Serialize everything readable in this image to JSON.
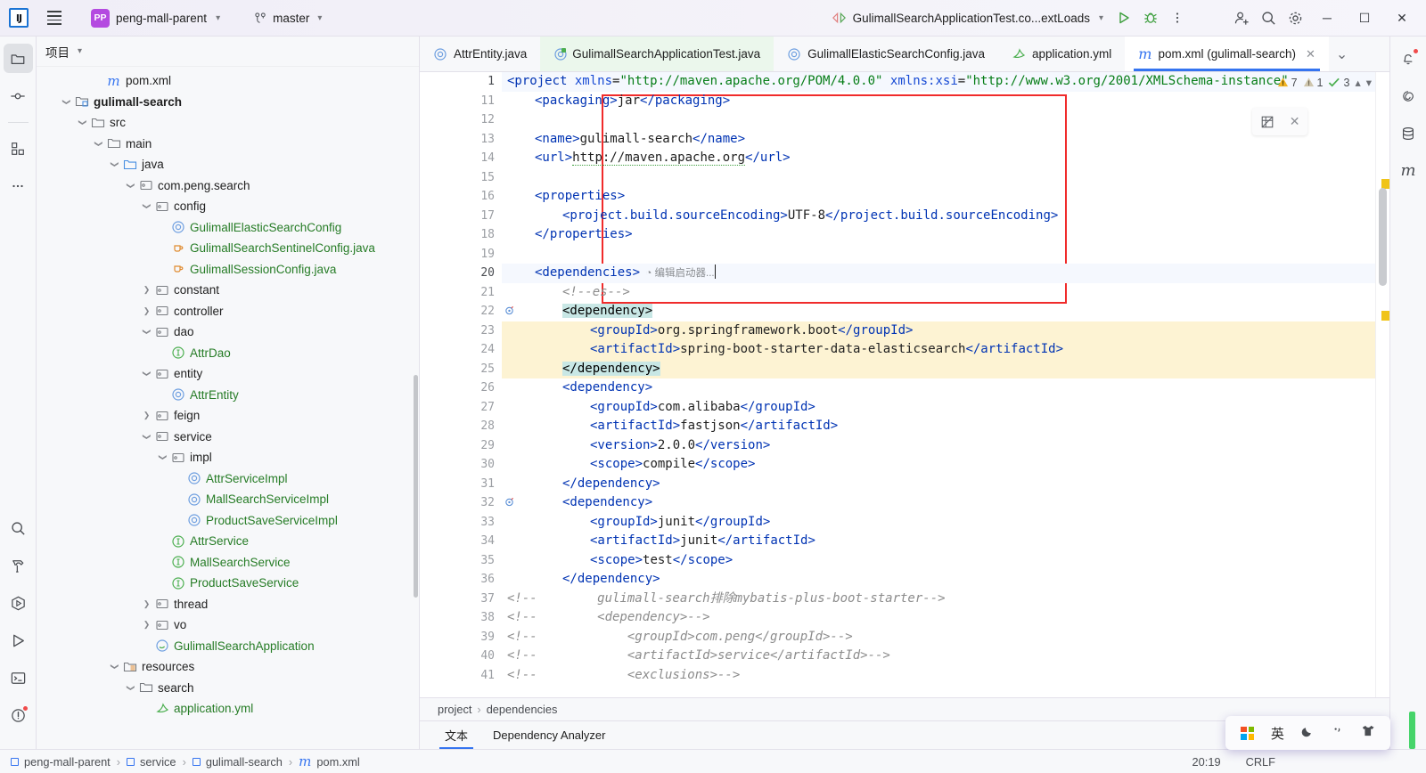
{
  "titlebar": {
    "logo": "IJ",
    "project_name": "peng-mall-parent",
    "project_badge": "PP",
    "branch": "master",
    "run_config": "GulimallSearchApplicationTest.co...extLoads",
    "icons": {
      "menu": "hamburger-icon",
      "branch": "vcs-branch-icon",
      "run": "run-icon",
      "debug": "debug-icon",
      "more": "more-vertical-icon",
      "add_user": "add-user-icon",
      "search": "search-icon",
      "settings": "gear-icon"
    },
    "window": {
      "minimize": "─",
      "maximize": "☐",
      "close": "✕"
    }
  },
  "left_rail": [
    {
      "name": "project",
      "icon": "folder-icon",
      "selected": true
    },
    {
      "name": "commit",
      "icon": "commit-icon",
      "selected": false
    },
    {
      "name": "structure",
      "icon": "structure-icon",
      "selected": false
    },
    {
      "name": "more-tool-windows",
      "icon": "more-horizontal-icon",
      "selected": false
    },
    {
      "name": "search-everywhere",
      "icon": "search-icon",
      "selected": false
    },
    {
      "name": "build",
      "icon": "hammer-icon",
      "selected": false
    },
    {
      "name": "run-dashboard",
      "icon": "run-dashboard-icon",
      "selected": false
    },
    {
      "name": "run",
      "icon": "run-icon",
      "selected": false
    },
    {
      "name": "terminal",
      "icon": "terminal-icon",
      "selected": false
    },
    {
      "name": "problems",
      "icon": "problems-icon",
      "selected": false,
      "badge": true
    }
  ],
  "right_rail": [
    {
      "name": "notifications",
      "icon": "bell-icon",
      "badge": true
    },
    {
      "name": "ai-assistant",
      "icon": "spiral-icon",
      "badge": false
    },
    {
      "name": "database",
      "icon": "database-icon",
      "badge": false
    },
    {
      "name": "maven",
      "icon": "maven-m-icon",
      "badge": false
    }
  ],
  "project_panel": {
    "title": "项目",
    "tree": [
      {
        "indent": 3,
        "arrow": "",
        "icon": "maven-m",
        "label": "pom.xml",
        "color": "default",
        "bold": false
      },
      {
        "indent": 1,
        "arrow": "v",
        "icon": "module",
        "label": "gulimall-search",
        "color": "default",
        "bold": true
      },
      {
        "indent": 2,
        "arrow": "v",
        "icon": "folder",
        "label": "src",
        "color": "default",
        "bold": false
      },
      {
        "indent": 3,
        "arrow": "v",
        "icon": "folder",
        "label": "main",
        "color": "default",
        "bold": false
      },
      {
        "indent": 4,
        "arrow": "v",
        "icon": "src-folder",
        "label": "java",
        "color": "default",
        "bold": false
      },
      {
        "indent": 5,
        "arrow": "v",
        "icon": "package",
        "label": "com.peng.search",
        "color": "default",
        "bold": false
      },
      {
        "indent": 6,
        "arrow": "v",
        "icon": "package",
        "label": "config",
        "color": "default",
        "bold": false
      },
      {
        "indent": 7,
        "arrow": "",
        "icon": "class",
        "label": "GulimallElasticSearchConfig",
        "color": "green",
        "bold": false
      },
      {
        "indent": 7,
        "arrow": "",
        "icon": "java",
        "label": "GulimallSearchSentinelConfig.java",
        "color": "green",
        "bold": false
      },
      {
        "indent": 7,
        "arrow": "",
        "icon": "java",
        "label": "GulimallSessionConfig.java",
        "color": "green",
        "bold": false
      },
      {
        "indent": 6,
        "arrow": ">",
        "icon": "package",
        "label": "constant",
        "color": "default",
        "bold": false
      },
      {
        "indent": 6,
        "arrow": ">",
        "icon": "package",
        "label": "controller",
        "color": "default",
        "bold": false
      },
      {
        "indent": 6,
        "arrow": "v",
        "icon": "package",
        "label": "dao",
        "color": "default",
        "bold": false
      },
      {
        "indent": 7,
        "arrow": "",
        "icon": "interface",
        "label": "AttrDao",
        "color": "green",
        "bold": false
      },
      {
        "indent": 6,
        "arrow": "v",
        "icon": "package",
        "label": "entity",
        "color": "default",
        "bold": false
      },
      {
        "indent": 7,
        "arrow": "",
        "icon": "class",
        "label": "AttrEntity",
        "color": "green",
        "bold": false
      },
      {
        "indent": 6,
        "arrow": ">",
        "icon": "package",
        "label": "feign",
        "color": "default",
        "bold": false
      },
      {
        "indent": 6,
        "arrow": "v",
        "icon": "package",
        "label": "service",
        "color": "default",
        "bold": false
      },
      {
        "indent": 7,
        "arrow": "v",
        "icon": "package",
        "label": "impl",
        "color": "default",
        "bold": false
      },
      {
        "indent": 8,
        "arrow": "",
        "icon": "class",
        "label": "AttrServiceImpl",
        "color": "green",
        "bold": false
      },
      {
        "indent": 8,
        "arrow": "",
        "icon": "class",
        "label": "MallSearchServiceImpl",
        "color": "green",
        "bold": false
      },
      {
        "indent": 8,
        "arrow": "",
        "icon": "class",
        "label": "ProductSaveServiceImpl",
        "color": "green",
        "bold": false
      },
      {
        "indent": 7,
        "arrow": "",
        "icon": "interface",
        "label": "AttrService",
        "color": "green",
        "bold": false
      },
      {
        "indent": 7,
        "arrow": "",
        "icon": "interface",
        "label": "MallSearchService",
        "color": "green",
        "bold": false
      },
      {
        "indent": 7,
        "arrow": "",
        "icon": "interface",
        "label": "ProductSaveService",
        "color": "green",
        "bold": false
      },
      {
        "indent": 6,
        "arrow": ">",
        "icon": "package",
        "label": "thread",
        "color": "default",
        "bold": false
      },
      {
        "indent": 6,
        "arrow": ">",
        "icon": "package",
        "label": "vo",
        "color": "default",
        "bold": false
      },
      {
        "indent": 6,
        "arrow": "",
        "icon": "spring",
        "label": "GulimallSearchApplication",
        "color": "green",
        "bold": false
      },
      {
        "indent": 4,
        "arrow": "v",
        "icon": "resources",
        "label": "resources",
        "color": "default",
        "bold": false
      },
      {
        "indent": 5,
        "arrow": "v",
        "icon": "folder",
        "label": "search",
        "color": "default",
        "bold": false
      },
      {
        "indent": 6,
        "arrow": "",
        "icon": "yml",
        "label": "application.yml",
        "color": "green",
        "bold": false
      }
    ]
  },
  "editor_tabs": [
    {
      "label": "AttrEntity.java",
      "icon": "class-icon",
      "state": "normal"
    },
    {
      "label": "GulimallSearchApplicationTest.java",
      "icon": "test-class-icon",
      "state": "run-context"
    },
    {
      "label": "GulimallElasticSearchConfig.java",
      "icon": "class-icon",
      "state": "normal"
    },
    {
      "label": "application.yml",
      "icon": "yml-icon",
      "state": "normal"
    },
    {
      "label": "pom.xml (gulimall-search)",
      "icon": "maven-m-icon",
      "state": "active"
    }
  ],
  "inspections": {
    "warnings": "7",
    "weak_warnings": "1",
    "checks": "3"
  },
  "code": {
    "filename": "pom.xml",
    "inlay_hint": "编辑启动器...",
    "lines": [
      {
        "num": "1",
        "indent": 0,
        "current": true,
        "highlight": false,
        "mark": "",
        "parts": [
          {
            "t": "tag",
            "v": "<project "
          },
          {
            "t": "attr",
            "v": "xmlns"
          },
          {
            "t": "val",
            "v": "="
          },
          {
            "t": "str",
            "v": "\"http://maven.apache.org/POM/4.0.0\""
          },
          {
            "t": "val",
            "v": " "
          },
          {
            "t": "attr",
            "v": "xmlns:xsi"
          },
          {
            "t": "val",
            "v": "="
          },
          {
            "t": "str",
            "v": "\"http://www.w3.org/2001/XMLSchema-instance\""
          }
        ]
      },
      {
        "num": "11",
        "indent": 1,
        "current": false,
        "highlight": false,
        "mark": "",
        "parts": [
          {
            "t": "tag",
            "v": "<packaging>"
          },
          {
            "t": "val",
            "v": "jar"
          },
          {
            "t": "tag",
            "v": "</packaging>"
          }
        ]
      },
      {
        "num": "12",
        "indent": 0,
        "current": false,
        "highlight": false,
        "mark": "",
        "parts": []
      },
      {
        "num": "13",
        "indent": 1,
        "current": false,
        "highlight": false,
        "mark": "",
        "parts": [
          {
            "t": "tag",
            "v": "<name>"
          },
          {
            "t": "val",
            "v": "gulimall-search"
          },
          {
            "t": "tag",
            "v": "</name>"
          }
        ]
      },
      {
        "num": "14",
        "indent": 1,
        "current": false,
        "highlight": false,
        "mark": "",
        "parts": [
          {
            "t": "tag",
            "v": "<url>"
          },
          {
            "t": "wiggle",
            "v": "http://maven.apache.org"
          },
          {
            "t": "tag",
            "v": "</url>"
          }
        ]
      },
      {
        "num": "15",
        "indent": 0,
        "current": false,
        "highlight": false,
        "mark": "",
        "parts": []
      },
      {
        "num": "16",
        "indent": 1,
        "current": false,
        "highlight": false,
        "mark": "",
        "parts": [
          {
            "t": "tag",
            "v": "<properties>"
          }
        ]
      },
      {
        "num": "17",
        "indent": 2,
        "current": false,
        "highlight": false,
        "mark": "",
        "parts": [
          {
            "t": "tag",
            "v": "<project.build.sourceEncoding>"
          },
          {
            "t": "val",
            "v": "UTF-8"
          },
          {
            "t": "tag",
            "v": "</project.build.sourceEncoding>"
          }
        ]
      },
      {
        "num": "18",
        "indent": 1,
        "current": false,
        "highlight": false,
        "mark": "",
        "parts": [
          {
            "t": "tag",
            "v": "</properties>"
          }
        ]
      },
      {
        "num": "19",
        "indent": 0,
        "current": false,
        "highlight": false,
        "mark": "",
        "parts": []
      },
      {
        "num": "20",
        "indent": 1,
        "current": true,
        "highlight": false,
        "mark": "",
        "parts": [
          {
            "t": "tag",
            "v": "<dependencies>"
          },
          {
            "t": "inlay",
            "v": "  ◔ 编辑启动器..."
          },
          {
            "t": "caret",
            "v": ""
          }
        ]
      },
      {
        "num": "21",
        "indent": 2,
        "current": false,
        "highlight": false,
        "mark": "",
        "parts": [
          {
            "t": "cmt",
            "v": "<!--es-->"
          }
        ]
      },
      {
        "num": "22",
        "indent": 2,
        "current": false,
        "highlight": false,
        "mark": "bean",
        "parts": [
          {
            "t": "sel",
            "v": "<dependency>"
          }
        ]
      },
      {
        "num": "23",
        "indent": 3,
        "current": false,
        "highlight": true,
        "mark": "",
        "parts": [
          {
            "t": "tag",
            "v": "<groupId>"
          },
          {
            "t": "val",
            "v": "org.springframework.boot"
          },
          {
            "t": "tag",
            "v": "</groupId>"
          }
        ]
      },
      {
        "num": "24",
        "indent": 3,
        "current": false,
        "highlight": true,
        "mark": "",
        "parts": [
          {
            "t": "tag",
            "v": "<artifactId>"
          },
          {
            "t": "val",
            "v": "spring-boot-starter-data-elasticsearch"
          },
          {
            "t": "tag",
            "v": "</artifactId>"
          }
        ]
      },
      {
        "num": "25",
        "indent": 2,
        "current": false,
        "highlight": true,
        "mark": "",
        "parts": [
          {
            "t": "sel",
            "v": "</dependency>"
          }
        ]
      },
      {
        "num": "26",
        "indent": 2,
        "current": false,
        "highlight": false,
        "mark": "",
        "parts": [
          {
            "t": "tag",
            "v": "<dependency>"
          }
        ]
      },
      {
        "num": "27",
        "indent": 3,
        "current": false,
        "highlight": false,
        "mark": "",
        "parts": [
          {
            "t": "tag",
            "v": "<groupId>"
          },
          {
            "t": "val",
            "v": "com.alibaba"
          },
          {
            "t": "tag",
            "v": "</groupId>"
          }
        ]
      },
      {
        "num": "28",
        "indent": 3,
        "current": false,
        "highlight": false,
        "mark": "",
        "parts": [
          {
            "t": "tag",
            "v": "<artifactId>"
          },
          {
            "t": "val",
            "v": "fastjson"
          },
          {
            "t": "tag",
            "v": "</artifactId>"
          }
        ]
      },
      {
        "num": "29",
        "indent": 3,
        "current": false,
        "highlight": false,
        "mark": "",
        "parts": [
          {
            "t": "tag",
            "v": "<version>"
          },
          {
            "t": "val",
            "v": "2.0.0"
          },
          {
            "t": "tag",
            "v": "</version>"
          }
        ]
      },
      {
        "num": "30",
        "indent": 3,
        "current": false,
        "highlight": false,
        "mark": "",
        "parts": [
          {
            "t": "tag",
            "v": "<scope>"
          },
          {
            "t": "val",
            "v": "compile"
          },
          {
            "t": "tag",
            "v": "</scope>"
          }
        ]
      },
      {
        "num": "31",
        "indent": 2,
        "current": false,
        "highlight": false,
        "mark": "",
        "parts": [
          {
            "t": "tag",
            "v": "</dependency>"
          }
        ]
      },
      {
        "num": "32",
        "indent": 2,
        "current": false,
        "highlight": false,
        "mark": "bean",
        "parts": [
          {
            "t": "tag",
            "v": "<dependency>"
          }
        ]
      },
      {
        "num": "33",
        "indent": 3,
        "current": false,
        "highlight": false,
        "mark": "",
        "parts": [
          {
            "t": "tag",
            "v": "<groupId>"
          },
          {
            "t": "val",
            "v": "junit"
          },
          {
            "t": "tag",
            "v": "</groupId>"
          }
        ]
      },
      {
        "num": "34",
        "indent": 3,
        "current": false,
        "highlight": false,
        "mark": "",
        "parts": [
          {
            "t": "tag",
            "v": "<artifactId>"
          },
          {
            "t": "val",
            "v": "junit"
          },
          {
            "t": "tag",
            "v": "</artifactId>"
          }
        ]
      },
      {
        "num": "35",
        "indent": 3,
        "current": false,
        "highlight": false,
        "mark": "",
        "parts": [
          {
            "t": "tag",
            "v": "<scope>"
          },
          {
            "t": "val",
            "v": "test"
          },
          {
            "t": "tag",
            "v": "</scope>"
          }
        ]
      },
      {
        "num": "36",
        "indent": 2,
        "current": false,
        "highlight": false,
        "mark": "",
        "parts": [
          {
            "t": "tag",
            "v": "</dependency>"
          }
        ]
      },
      {
        "num": "37",
        "indent": 0,
        "current": false,
        "highlight": false,
        "mark": "",
        "parts": [
          {
            "t": "cmt",
            "v": "<!--        gulimall-search排除mybatis-plus-boot-starter-->"
          }
        ]
      },
      {
        "num": "38",
        "indent": 0,
        "current": false,
        "highlight": false,
        "mark": "",
        "parts": [
          {
            "t": "cmt",
            "v": "<!--        <dependency>-->"
          }
        ]
      },
      {
        "num": "39",
        "indent": 0,
        "current": false,
        "highlight": false,
        "mark": "",
        "parts": [
          {
            "t": "cmt",
            "v": "<!--            <groupId>com.peng</groupId>-->"
          }
        ]
      },
      {
        "num": "40",
        "indent": 0,
        "current": false,
        "highlight": false,
        "mark": "",
        "parts": [
          {
            "t": "cmt",
            "v": "<!--            <artifactId>service</artifactId>-->"
          }
        ]
      },
      {
        "num": "41",
        "indent": 0,
        "current": false,
        "highlight": false,
        "mark": "",
        "parts": [
          {
            "t": "cmt",
            "v": "<!--            <exclusions>-->"
          }
        ]
      }
    ]
  },
  "breadcrumb": {
    "items": [
      "project",
      "dependencies"
    ],
    "separator": "›"
  },
  "bottom_tabs": [
    {
      "label": "文本",
      "active": true
    },
    {
      "label": "Dependency Analyzer",
      "active": false
    }
  ],
  "status_bar": {
    "crumbs": [
      "peng-mall-parent",
      "service",
      "gulimall-search",
      "pom.xml"
    ],
    "separator": "›",
    "position": "20:19",
    "line_sep": "CRLF"
  },
  "ime_popup": {
    "lang": "英",
    "icons": [
      "windows-icon",
      "lang-icon",
      "moon-icon",
      "comma-icon",
      "shirt-icon"
    ]
  },
  "colors": {
    "accent": "#3574f0",
    "tag": "#0033b3",
    "string": "#067d17",
    "comment": "#8c8c8c",
    "highlight": "#fdf3d3",
    "selection": "#c8e7e5",
    "redbox": "#f02b2b",
    "green_label": "#267c26"
  }
}
